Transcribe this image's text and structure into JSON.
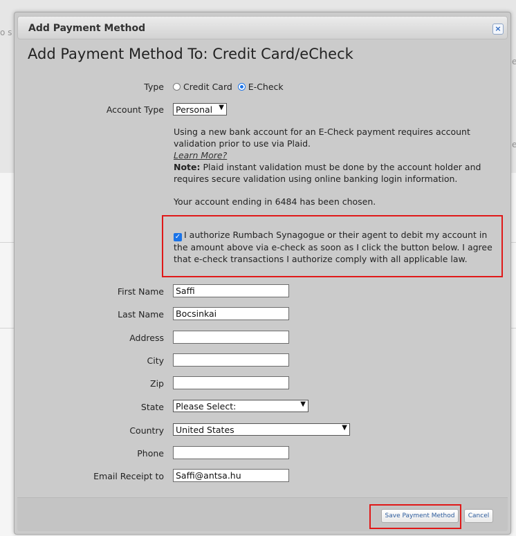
{
  "background": {
    "fragments": [
      "o s",
      "e",
      "e"
    ]
  },
  "dialog": {
    "title": "Add Payment Method",
    "close_glyph": "×",
    "heading": "Add Payment Method To: Credit Card/eCheck"
  },
  "form": {
    "type": {
      "label": "Type",
      "options": [
        "Credit Card",
        "E-Check"
      ],
      "selected": "E-Check"
    },
    "account_type": {
      "label": "Account Type",
      "value": "Personal"
    },
    "info": {
      "bold_text": "Using a new bank account for an E-Check payment requires account validation prior to use via Plaid.",
      "learn_more": "Learn More?",
      "note_label": "Note:",
      "note_text": " Plaid instant validation must be done by the account holder and requires secure validation using online banking login information.",
      "chosen_text": "Your account ending in 6484 has been chosen."
    },
    "authorization": {
      "checked": true,
      "text": "I authorize Rumbach Synagogue or their agent to debit my account in the amount above via e-check as soon as I click the button below. I agree that e-check transactions I authorize comply with all applicable law."
    },
    "fields": {
      "first_name": {
        "label": "First Name",
        "value": "Saffi"
      },
      "last_name": {
        "label": "Last Name",
        "value": "Bocsinkai"
      },
      "address": {
        "label": "Address",
        "value": ""
      },
      "city": {
        "label": "City",
        "value": ""
      },
      "zip": {
        "label": "Zip",
        "value": ""
      },
      "state": {
        "label": "State",
        "value": "Please Select:"
      },
      "country": {
        "label": "Country",
        "value": "United States"
      },
      "phone": {
        "label": "Phone",
        "value": ""
      },
      "email": {
        "label": "Email Receipt to",
        "value": "Saffi@antsa.hu"
      }
    }
  },
  "footer": {
    "save_label": "Save Payment Method",
    "cancel_label": "Cancel"
  },
  "colors": {
    "highlight": "#e01818",
    "accent": "#1a73e8"
  }
}
